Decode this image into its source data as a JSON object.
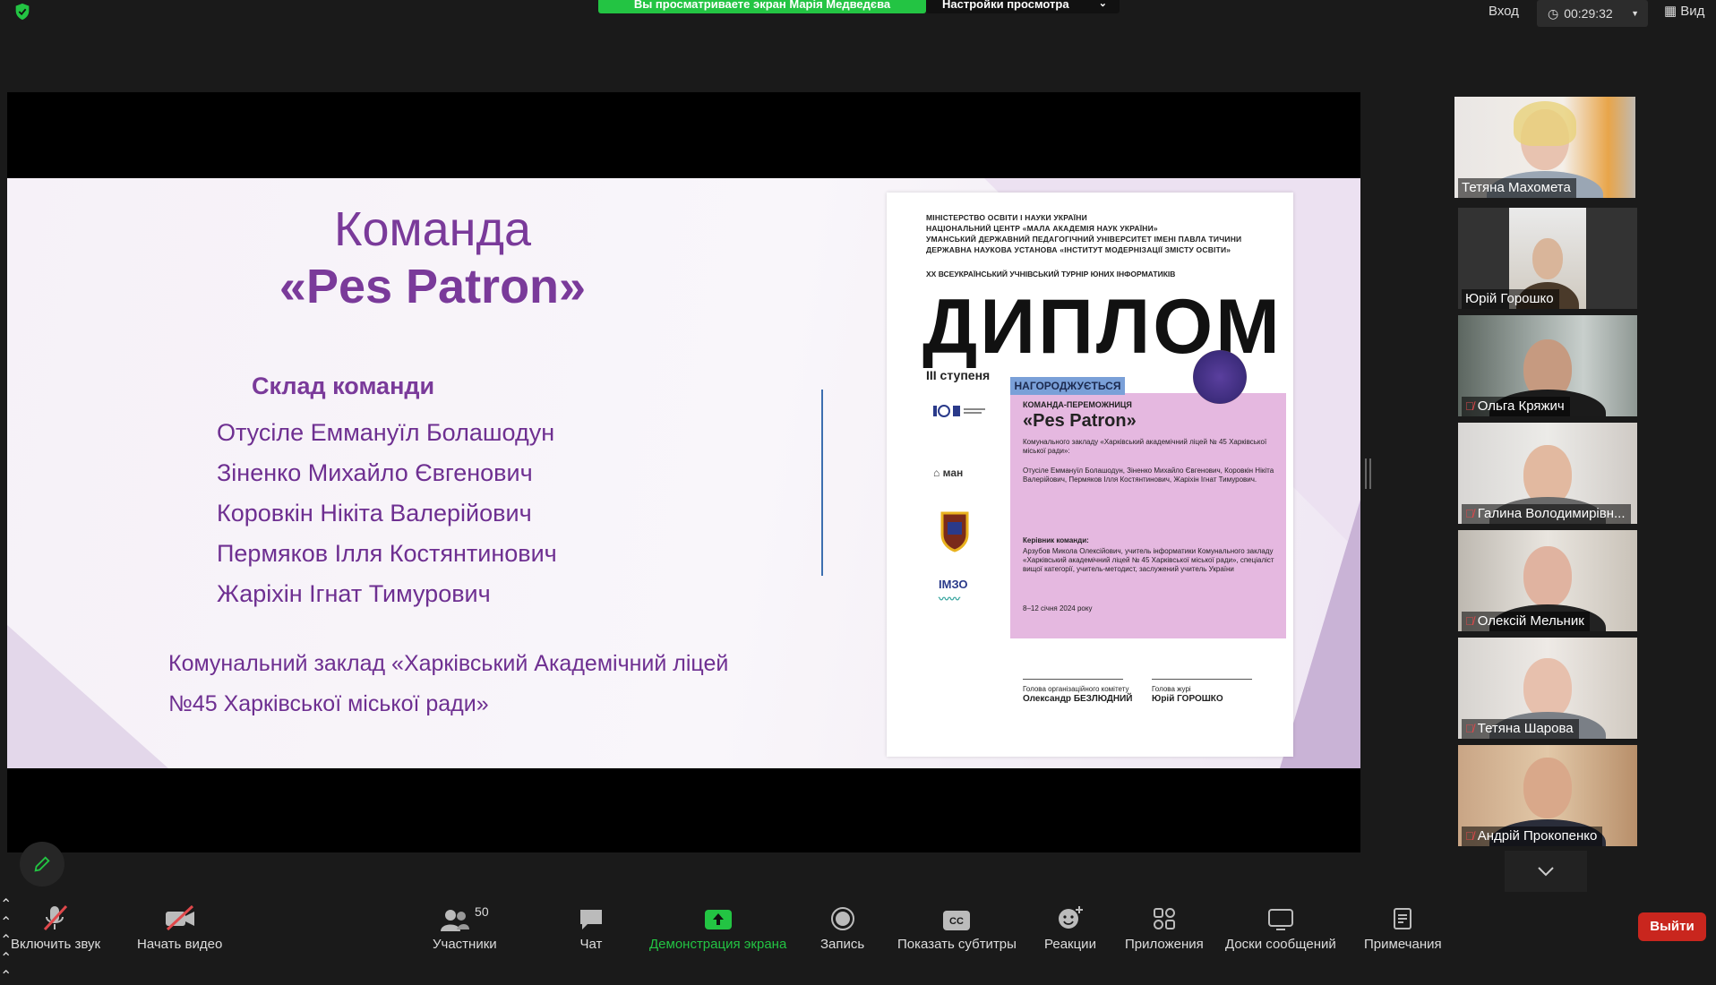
{
  "top_bar": {
    "share_banner": "Вы просматриваете экран Марія Медведєва",
    "view_options": "Настройки просмотра",
    "login": "Вход",
    "timer": "00:29:32",
    "view": "Вид"
  },
  "slide": {
    "title": "Команда",
    "team_name": "«Pes Patron»",
    "composition_heading": "Склад команди",
    "members": [
      "Отусіле Еммануїл Болашодун",
      "Зіненко Михайло Євгенович",
      "Коровкін Нікіта Валерійович",
      "Пермяков Ілля Костянтинович",
      "Жаріхін Ігнат Тимурович"
    ],
    "school_line1": "Комунальний заклад «Харківський Академічний ліцей",
    "school_line2": "№45 Харківської міської ради»",
    "diploma": {
      "header_lines": [
        "МІНІСТЕРСТВО ОСВІТИ І НАУКИ УКРАЇНИ",
        "НАЦІОНАЛЬНИЙ ЦЕНТР «МАЛА АКАДЕМІЯ НАУК УКРАЇНИ»",
        "УМАНСЬКИЙ ДЕРЖАВНИЙ ПЕДАГОГІЧНИЙ УНІВЕРСИТЕТ ІМЕНІ ПАВЛА ТИЧИНИ",
        "ДЕРЖАВНА НАУКОВА УСТАНОВА «ІНСТИТУТ МОДЕРНІЗАЦІЇ ЗМІСТУ ОСВІТИ»"
      ],
      "tournament": "XX ВСЕУКРАЇНСЬКИЙ УЧНІВСЬКИЙ ТУРНІР ЮНИХ ІНФОРМАТИКІВ",
      "title": "ДИПЛОМ",
      "degree": "ІІІ ступеня",
      "award_tag": "НАГОРОДЖУЄТЬСЯ",
      "winner_label": "КОМАНДА-ПЕРЕМОЖНИЦЯ",
      "team": "«Pes Patron»",
      "institution": "Комунального закладу «Харківський академічний ліцей № 45 Харківської міської ради»:",
      "members_text": "Отусіле Еммануїл Болашодун, Зіненко Михайло Євгенович, Коровкін Нікіта Валерійович, Пермяков Ілля Костянтинович, Жаріхін Ігнат Тимурович.",
      "leader_label": "Керівник команди:",
      "leader_text": "Арзубов Микола Олексійович, учитель інформатики Комунального закладу «Харківський академічний ліцей № 45 Харківської міської ради», спеціаліст вищої категорії, учитель-методист, заслужений учитель України",
      "date": "8–12 січня 2024 року",
      "logo_mzn": "ман",
      "logo_imzo": "ІМЗО",
      "sign1_role": "Голова організаційного комітету",
      "sign1_name": "Олександр БЕЗЛЮДНИЙ",
      "sign2_role": "Голова журі",
      "sign2_name": "Юрій ГОРОШКО"
    }
  },
  "participants": [
    {
      "name": "Тетяна Махомета",
      "muted": false,
      "active": true
    },
    {
      "name": "Юрій Горошко",
      "muted": false,
      "active": false
    },
    {
      "name": "Ольга Кряжич",
      "muted": true,
      "active": false
    },
    {
      "name": "Галина Володимирівн...",
      "muted": true,
      "active": false
    },
    {
      "name": "Олексій Мельник",
      "muted": true,
      "active": false
    },
    {
      "name": "Тетяна Шарова",
      "muted": true,
      "active": false
    },
    {
      "name": "Андрій Прокопенко",
      "muted": true,
      "active": false
    }
  ],
  "toolbar": {
    "unmute": "Включить звук",
    "start_video": "Начать видео",
    "participants": "Участники",
    "participants_count": "50",
    "chat": "Чат",
    "share_screen": "Демонстрация экрана",
    "record": "Запись",
    "captions": "Показать субтитры",
    "reactions": "Реакции",
    "apps": "Приложения",
    "whiteboards": "Доски сообщений",
    "notes": "Примечания",
    "leave": "Выйти"
  },
  "colors": {
    "accent_green": "#23c443",
    "slide_purple": "#7a3a9a",
    "leave_red": "#c9261e",
    "active_speaker": "#e9e37d"
  }
}
